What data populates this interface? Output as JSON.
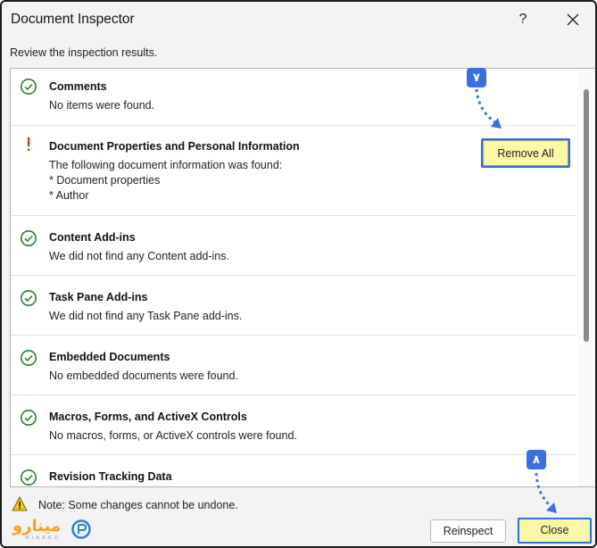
{
  "window": {
    "title": "Document Inspector",
    "help_label": "?"
  },
  "instruction": "Review the inspection results.",
  "results": [
    {
      "status": "ok",
      "title": "Comments",
      "lines": [
        "No items were found."
      ]
    },
    {
      "status": "warning",
      "title": "Document Properties and Personal Information",
      "lines": [
        "The following document information was found:",
        "* Document properties",
        "* Author"
      ],
      "action_label": "Remove All"
    },
    {
      "status": "ok",
      "title": "Content Add-ins",
      "lines": [
        "We did not find any Content add-ins."
      ]
    },
    {
      "status": "ok",
      "title": "Task Pane Add-ins",
      "lines": [
        "We did not find any Task Pane add-ins."
      ]
    },
    {
      "status": "ok",
      "title": "Embedded Documents",
      "lines": [
        "No embedded documents were found."
      ]
    },
    {
      "status": "ok",
      "title": "Macros, Forms, and ActiveX Controls",
      "lines": [
        "No macros, forms, or ActiveX controls were found."
      ]
    },
    {
      "status": "ok",
      "title": "Revision Tracking Data",
      "lines": []
    }
  ],
  "note": "Note: Some changes cannot be undone.",
  "buttons": {
    "reinspect": "Reinspect",
    "close": "Close"
  },
  "annotations": {
    "step_7": "۷",
    "step_8": "۸"
  },
  "logo": {
    "text": "مینارو",
    "sub": "MINARO"
  },
  "colors": {
    "ok_green": "#2e7d32",
    "warning_red": "#c42b1c",
    "highlight": "#fbf8a8",
    "annotation_blue": "#3b6fe0"
  }
}
